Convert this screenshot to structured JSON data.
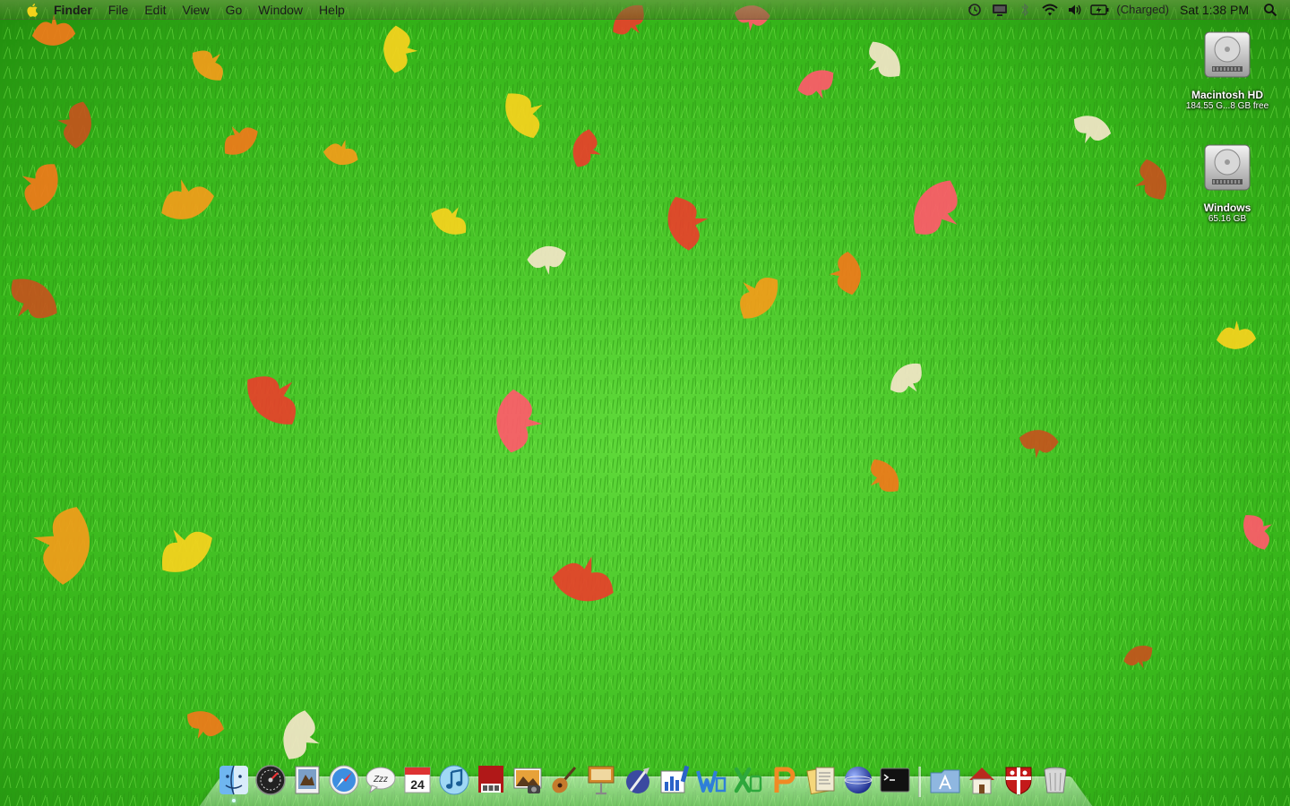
{
  "menubar": {
    "app_name": "Finder",
    "menus": [
      "File",
      "Edit",
      "View",
      "Go",
      "Window",
      "Help"
    ],
    "battery_status": "(Charged)",
    "clock": "Sat 1:38 PM"
  },
  "desktop_icons": [
    {
      "name": "Macintosh HD",
      "detail": "184.55 G...8 GB free"
    },
    {
      "name": "Windows",
      "detail": "65.16 GB"
    }
  ],
  "dock": {
    "calendar_day": "24",
    "apps": [
      "finder-icon",
      "dashboard-icon",
      "preview-icon",
      "safari-icon",
      "ichat-icon",
      "ical-icon",
      "itunes-icon",
      "photo-booth-icon",
      "iphoto-icon",
      "garageband-icon",
      "keynote-icon",
      "quill-icon",
      "charts-icon",
      "word-icon",
      "excel-icon",
      "powerpoint-icon",
      "office-doc-icon",
      "globe-icon",
      "terminal-icon"
    ],
    "others": [
      "applications-folder-icon",
      "home-icon",
      "shield-app-icon",
      "trash-icon"
    ]
  },
  "colors": {
    "grass": "#3fbf1e",
    "grass_dark": "#1f8a0c"
  }
}
